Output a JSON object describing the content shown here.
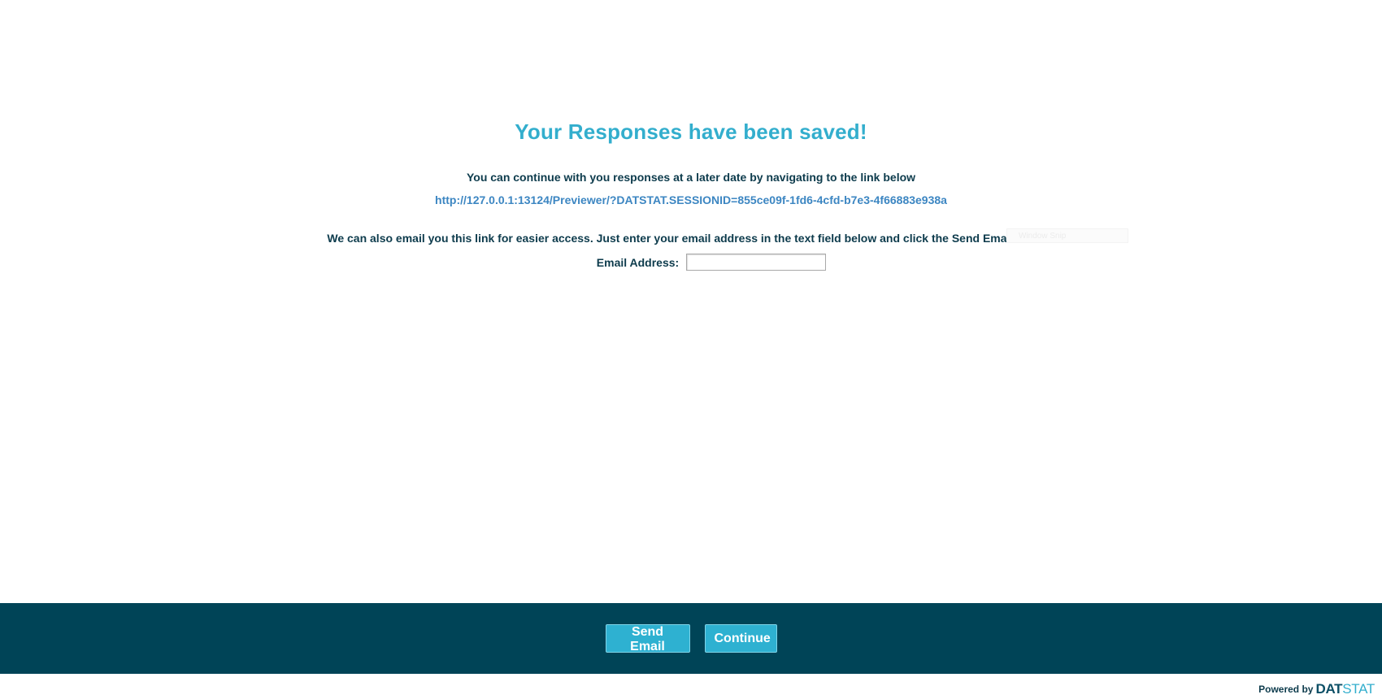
{
  "main": {
    "title": "Your Responses have been saved!",
    "instructions": "You can continue with you responses at a later date by navigating to the link below",
    "session_link": "http://127.0.0.1:13124/Previewer/?DATSTAT.SESSIONID=855ce09f-1fd6-4cfd-b7e3-4f66883e938a",
    "email_info": "We can also email you this link for easier access. Just enter your email address in the text field below and click the Send Email button.",
    "email_label": "Email Address:",
    "email_value": "",
    "ghost_overlay": "Window Snip"
  },
  "footer": {
    "send_email_label": "Send Email",
    "continue_label": "Continue",
    "powered_by": "Powered by",
    "brand_part1": "DAT",
    "brand_part2": "STAT"
  },
  "colors": {
    "accent": "#33aecd",
    "footer_bg": "#004457",
    "text": "#0d3b4c",
    "link": "#3c86c2"
  }
}
